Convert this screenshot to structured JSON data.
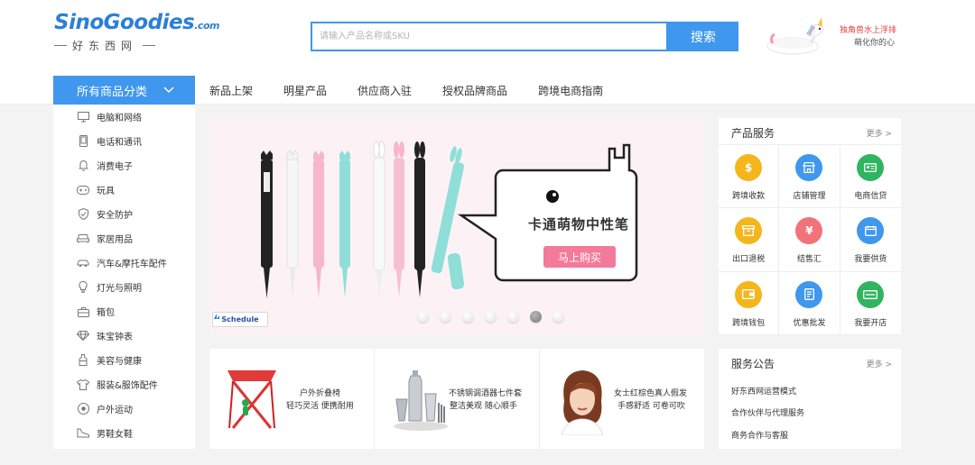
{
  "header": {
    "logo_text": "SinoGoodies",
    "logo_domain": ".com",
    "logo_sub": "好东西网",
    "search_placeholder": "请输入产品名称或SKU",
    "search_button": "搜索",
    "promo_line1": "独角兽水上浮排",
    "promo_line2": "萌化你的心"
  },
  "nav": {
    "category_button": "所有商品分类",
    "links": [
      "新品上架",
      "明星产品",
      "供应商入驻",
      "授权品牌商品",
      "跨境电商指南"
    ]
  },
  "categories": [
    {
      "label": "电脑和网络",
      "icon": "monitor-icon"
    },
    {
      "label": "电话和通讯",
      "icon": "phone-icon"
    },
    {
      "label": "消费电子",
      "icon": "bell-icon"
    },
    {
      "label": "玩具",
      "icon": "gamepad-icon"
    },
    {
      "label": "安全防护",
      "icon": "shield-icon"
    },
    {
      "label": "家居用品",
      "icon": "sofa-icon"
    },
    {
      "label": "汽车&摩托车配件",
      "icon": "car-icon"
    },
    {
      "label": "灯光与照明",
      "icon": "bulb-icon"
    },
    {
      "label": "箱包",
      "icon": "bag-icon"
    },
    {
      "label": "珠宝钟表",
      "icon": "diamond-icon"
    },
    {
      "label": "美容与健康",
      "icon": "bottle-icon"
    },
    {
      "label": "服装&服饰配件",
      "icon": "shirt-icon"
    },
    {
      "label": "户外运动",
      "icon": "ball-icon"
    },
    {
      "label": "男鞋女鞋",
      "icon": "shoe-icon"
    }
  ],
  "banner": {
    "title": "卡通萌物中性笔",
    "cta": "马上购买",
    "schedule_label": "Schedule",
    "slide_count": 7,
    "active_slide": 6
  },
  "services": {
    "title": "产品服务",
    "more": "更多 >",
    "items": [
      {
        "label": "跨境收款",
        "icon": "coin-icon",
        "color": "#f5b51c"
      },
      {
        "label": "店铺管理",
        "icon": "store-icon",
        "color": "#3f97ee"
      },
      {
        "label": "电商信贷",
        "icon": "card-icon",
        "color": "#2fb560"
      },
      {
        "label": "出口退税",
        "icon": "box-icon",
        "color": "#f5b51c"
      },
      {
        "label": "结售汇",
        "icon": "exchange-icon",
        "color": "#f2727a"
      },
      {
        "label": "我要供货",
        "icon": "calendar-icon",
        "color": "#3f97ee"
      },
      {
        "label": "跨境钱包",
        "icon": "wallet-icon",
        "color": "#f5b51c"
      },
      {
        "label": "优惠批发",
        "icon": "tag-icon",
        "color": "#3f97ee"
      },
      {
        "label": "我要开店",
        "icon": "open-shop-icon",
        "color": "#2fb560"
      }
    ]
  },
  "notice": {
    "title": "服务公告",
    "more": "更多 >",
    "items": [
      "好东西网运营模式",
      "合作伙伴与代理服务",
      "商务合作与客服"
    ]
  },
  "cards": [
    {
      "line1": "户外折叠椅",
      "line2": "轻巧灵活 便携耐用",
      "icon": "folding-chair-icon"
    },
    {
      "line1": "不锈钢调酒器七件套",
      "line2": "整洁美观 随心顺手",
      "icon": "cocktail-set-icon"
    },
    {
      "line1": "女士红棕色真人假发",
      "line2": "手感舒适 可卷可吹",
      "icon": "wig-model-icon"
    }
  ]
}
